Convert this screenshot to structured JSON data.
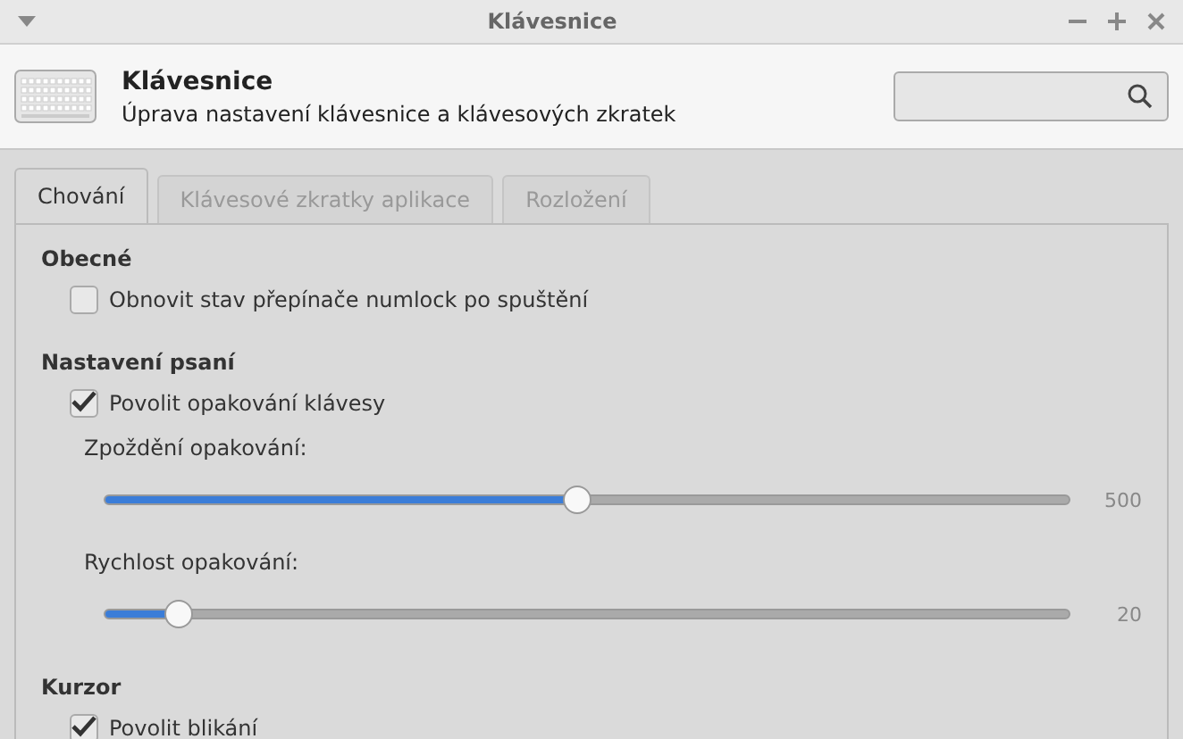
{
  "window": {
    "title": "Klávesnice"
  },
  "header": {
    "title": "Klávesnice",
    "subtitle": "Úprava nastavení klávesnice a klávesových zkratek"
  },
  "tabs": [
    {
      "label": "Chování",
      "selected": true
    },
    {
      "label": "Klávesové zkratky aplikace",
      "selected": false
    },
    {
      "label": "Rozložení",
      "selected": false
    }
  ],
  "sections": [
    {
      "title": "Obecné",
      "items": [
        {
          "kind": "checkbox",
          "label": "Obnovit stav přepínače numlock po spuštění",
          "checked": false
        }
      ]
    },
    {
      "title": "Nastavení psaní",
      "items": [
        {
          "kind": "checkbox",
          "label": "Povolit opakování klávesy",
          "checked": true
        },
        {
          "kind": "slider",
          "label": "Zpoždění opakování:",
          "level": 0.49,
          "reading": "500"
        },
        {
          "kind": "slider",
          "label": "Rychlost opakování:",
          "level": 0.077,
          "reading": "20"
        }
      ]
    },
    {
      "title": "Kurzor",
      "items": [
        {
          "kind": "checkbox",
          "label": "Povolit blikání",
          "checked": true
        }
      ]
    }
  ]
}
